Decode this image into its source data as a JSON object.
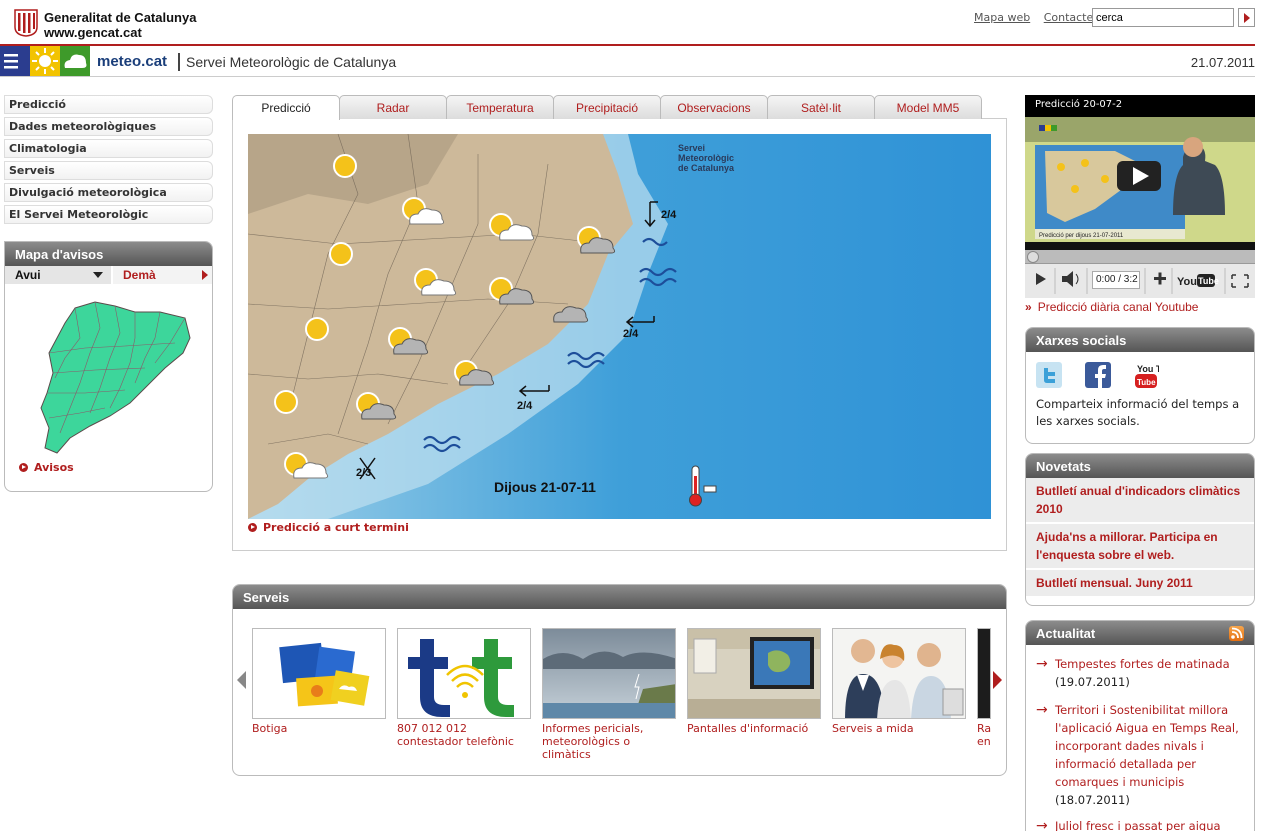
{
  "gencat": {
    "name_line1": "Generalitat de Catalunya",
    "name_line2": "www.gencat.cat",
    "link_map": "Mapa web",
    "link_contact": "Contacte",
    "search_value": "cerca"
  },
  "meteo": {
    "title": "meteo.cat",
    "subtitle": "Servei Meteorològic de Catalunya",
    "date": "21.07.2011"
  },
  "left_nav": {
    "items": [
      {
        "label": "Predicció"
      },
      {
        "label": "Dades meteorològiques"
      },
      {
        "label": "Climatologia"
      },
      {
        "label": "Serveis"
      },
      {
        "label": "Divulgació meteorològica"
      },
      {
        "label": "El Servei Meteorològic"
      }
    ]
  },
  "avisos": {
    "title": "Mapa d'avisos",
    "tab_today": "Avui",
    "tab_tomorrow": "Demà",
    "link": "Avisos",
    "map_color": "#3dd69b"
  },
  "tabs": [
    {
      "label": "Predicció"
    },
    {
      "label": "Radar"
    },
    {
      "label": "Temperatura"
    },
    {
      "label": "Precipitació"
    },
    {
      "label": "Observacions"
    },
    {
      "label": "Satèl·lit"
    },
    {
      "label": "Model MM5"
    }
  ],
  "forecast_map": {
    "logo_line1": "Servei",
    "logo_line2": "Meteorològic",
    "logo_line3": "de Catalunya",
    "day_label": "Dijous 21-07-11",
    "wind_labels": [
      "2/4",
      "2/4",
      "2/4",
      "2/3"
    ],
    "icons": [
      "sun-icon",
      "sun-cloud-icon",
      "cloud-icon",
      "waves-icon",
      "wind-arrow-icon",
      "thermometer-icon"
    ],
    "link": "Predicció a curt termini"
  },
  "serveis": {
    "title": "Serveis",
    "items": [
      {
        "label": "Botiga"
      },
      {
        "label": "807 012 012 contestador telefònic"
      },
      {
        "label": "Informes pericials, meteorològics o climàtics"
      },
      {
        "label": "Pantalles d'informació"
      },
      {
        "label": "Serveis a mida"
      },
      {
        "label": "Ra en"
      }
    ]
  },
  "video": {
    "title": "Predicció 20-07-2",
    "time": "0:00 / 3:2",
    "overlay_text": "Predicció per dijous 21-07-2011",
    "link": "Predicció diària canal Youtube"
  },
  "xarxes": {
    "title": "Xarxes socials",
    "youtube_label": "You Tube",
    "text": "Comparteix informació del temps a les xarxes socials."
  },
  "novetats": {
    "title": "Novetats",
    "items": [
      {
        "label": "Butlletí anual d'indicadors climàtics 2010"
      },
      {
        "label": "Ajuda'ns a millorar. Participa en l'enquesta sobre el web."
      },
      {
        "label": "Butlletí mensual. Juny 2011"
      }
    ]
  },
  "actualitat": {
    "title": "Actualitat",
    "items": [
      {
        "title": "Tempestes fortes de matinada",
        "date": "(19.07.2011)"
      },
      {
        "title": "Territori i Sostenibilitat millora l'aplicació Aigua en Temps Real, incorporant dades nivals i informació detallada per comarques i municipis",
        "date": "(18.07.2011)"
      },
      {
        "title": "Juliol fresc i passat per aigua",
        "date": ""
      }
    ]
  },
  "colors": {
    "accent_red": "#b01e1e",
    "brand_blue": "#1a3e7a",
    "sea_blue": "#3a9ad8",
    "land": "#c9b79a"
  }
}
